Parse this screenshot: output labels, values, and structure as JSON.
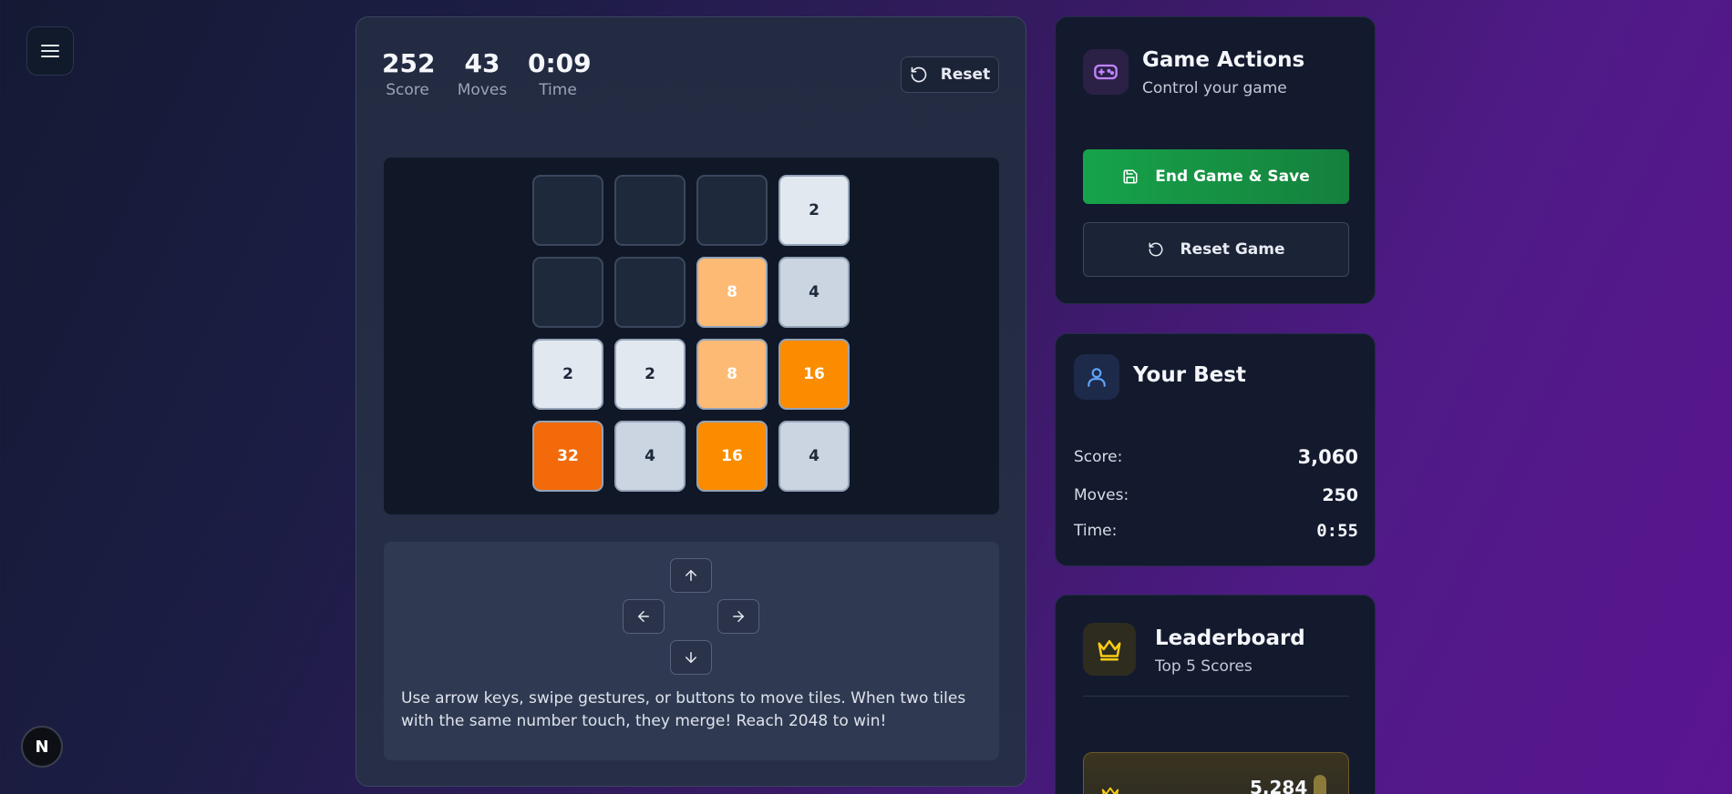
{
  "icons": {
    "menu": "hamburger-icon",
    "next_badge": "N"
  },
  "game": {
    "score": {
      "value": "252",
      "label": "Score"
    },
    "moves": {
      "value": "43",
      "label": "Moves"
    },
    "time": {
      "value": "0:09",
      "label": "Time"
    },
    "reset_label": "Reset",
    "board": [
      [
        "",
        "",
        "",
        "2"
      ],
      [
        "",
        "",
        "8",
        "4"
      ],
      [
        "2",
        "2",
        "8",
        "16"
      ],
      [
        "32",
        "4",
        "16",
        "4"
      ]
    ],
    "tile_colors": {
      "": {
        "bg": "#1e293b",
        "fg": "#e7eaf3",
        "border": "#3b475e"
      },
      "2": {
        "bg": "#e2e8f0",
        "fg": "#1e293b",
        "border": "#94a3b8"
      },
      "4": {
        "bg": "#cbd5e1",
        "fg": "#1e293b",
        "border": "#94a3b8"
      },
      "8": {
        "bg": "#fdba74",
        "fg": "#ffffff",
        "border": "#94a3b8"
      },
      "16": {
        "bg": "#fb8c00",
        "fg": "#ffffff",
        "border": "#94a3b8"
      },
      "32": {
        "bg": "#f26a0a",
        "fg": "#ffffff",
        "border": "#94a3b8"
      }
    },
    "help_text": "Use arrow keys, swipe gestures, or buttons to move tiles. When two tiles with the same number touch, they merge! Reach 2048 to win!"
  },
  "actions": {
    "title": "Game Actions",
    "subtitle": "Control your game",
    "end_label": "End Game & Save",
    "reset_label": "Reset Game"
  },
  "best": {
    "title": "Your Best",
    "rows": [
      {
        "label": "Score:",
        "value": "3,060"
      },
      {
        "label": "Moves:",
        "value": "250"
      },
      {
        "label": "Time:",
        "value": "0:55"
      }
    ]
  },
  "leaderboard": {
    "title": "Leaderboard",
    "subtitle": "Top 5 Scores",
    "entries": [
      {
        "score": "5,284"
      }
    ]
  }
}
